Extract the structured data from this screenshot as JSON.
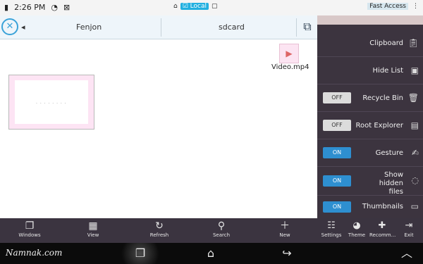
{
  "statusbar": {
    "time": "2:26 PM",
    "local_label": "Local",
    "fast_access": "Fast Access"
  },
  "breadcrumb": {
    "items": [
      "Fenjon",
      "sdcard"
    ]
  },
  "files": [
    {
      "name": "Video.mp4"
    }
  ],
  "thumbnail_text": "· · · ·   · · ·  ·",
  "toolbar": [
    {
      "label": "New",
      "icon": "plus-icon"
    },
    {
      "label": "Search",
      "icon": "search-icon"
    },
    {
      "label": "Refresh",
      "icon": "refresh-icon"
    },
    {
      "label": "View",
      "icon": "grid-icon"
    },
    {
      "label": "Windows",
      "icon": "windows-icon"
    }
  ],
  "sidebar": {
    "items": [
      {
        "label": "Clipboard",
        "icon": "clipboard-icon"
      },
      {
        "label": "Hide List",
        "icon": "hide-list-icon"
      },
      {
        "label": "Recycle Bin",
        "icon": "trash-icon",
        "toggle": "OFF"
      },
      {
        "label": "Root Explorer",
        "icon": "root-icon",
        "toggle": "OFF"
      },
      {
        "label": "Gesture",
        "icon": "gesture-icon",
        "toggle": "ON"
      },
      {
        "label": "Show hidden files",
        "icon": "hidden-files-icon",
        "toggle": "ON"
      },
      {
        "label": "Thumbnails",
        "icon": "thumbnails-icon",
        "toggle": "ON"
      }
    ],
    "bottom": [
      {
        "label": "Exit",
        "icon": "exit-icon"
      },
      {
        "label": "Recomm...",
        "icon": "recommend-icon"
      },
      {
        "label": "Theme",
        "icon": "theme-icon"
      },
      {
        "label": "Settings",
        "icon": "settings-icon"
      }
    ]
  },
  "navbar": {
    "watermark": "Namnak.com"
  },
  "colors": {
    "accent": "#2e8fd0",
    "sidebar_bg": "#3c343f"
  }
}
